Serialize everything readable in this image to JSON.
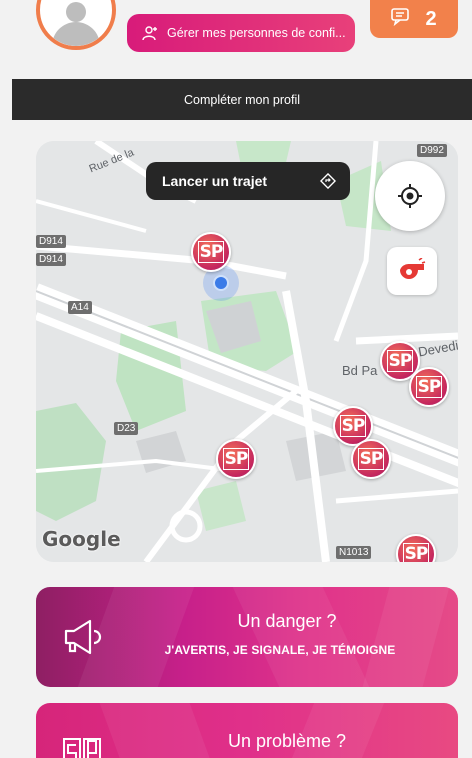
{
  "header": {
    "manage_contacts_label": "Gérer mes personnes de confi...",
    "chat_badge_count": "2",
    "complete_profile_label": "Compléter mon profil"
  },
  "map": {
    "trip_button_label": "Lancer un trajet",
    "street_labels": [
      "Rue de la",
      "Bd Pa",
      "Devedi"
    ],
    "road_badges": [
      "D992",
      "D914",
      "D914",
      "A14",
      "D23",
      "N1013"
    ],
    "attribution": "Google",
    "marker_label": "SP"
  },
  "cards": {
    "danger": {
      "title": "Un danger ?",
      "subtitle": "J'AVERTIS, JE SIGNALE, JE TÉMOIGNE"
    },
    "problem": {
      "title": "Un problème ?"
    }
  },
  "colors": {
    "accent_orange": "#f07d4b",
    "accent_pink": "#d81b7a",
    "bar_dark": "#2b2b2b"
  },
  "icons": [
    "user-add-icon",
    "chat-icon",
    "diamond-direction-icon",
    "locate-icon",
    "whistle-icon",
    "megaphone-icon",
    "sp-logo-icon"
  ]
}
